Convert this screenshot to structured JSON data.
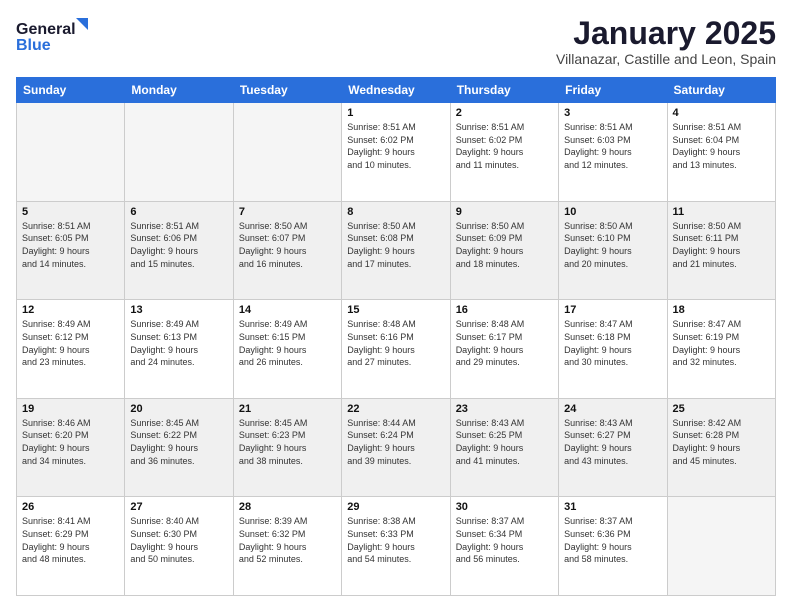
{
  "logo": {
    "line1": "General",
    "line2": "Blue"
  },
  "title": "January 2025",
  "location": "Villanazar, Castille and Leon, Spain",
  "weekdays": [
    "Sunday",
    "Monday",
    "Tuesday",
    "Wednesday",
    "Thursday",
    "Friday",
    "Saturday"
  ],
  "weeks": [
    [
      {
        "day": "",
        "info": ""
      },
      {
        "day": "",
        "info": ""
      },
      {
        "day": "",
        "info": ""
      },
      {
        "day": "1",
        "info": "Sunrise: 8:51 AM\nSunset: 6:02 PM\nDaylight: 9 hours\nand 10 minutes."
      },
      {
        "day": "2",
        "info": "Sunrise: 8:51 AM\nSunset: 6:02 PM\nDaylight: 9 hours\nand 11 minutes."
      },
      {
        "day": "3",
        "info": "Sunrise: 8:51 AM\nSunset: 6:03 PM\nDaylight: 9 hours\nand 12 minutes."
      },
      {
        "day": "4",
        "info": "Sunrise: 8:51 AM\nSunset: 6:04 PM\nDaylight: 9 hours\nand 13 minutes."
      }
    ],
    [
      {
        "day": "5",
        "info": "Sunrise: 8:51 AM\nSunset: 6:05 PM\nDaylight: 9 hours\nand 14 minutes."
      },
      {
        "day": "6",
        "info": "Sunrise: 8:51 AM\nSunset: 6:06 PM\nDaylight: 9 hours\nand 15 minutes."
      },
      {
        "day": "7",
        "info": "Sunrise: 8:50 AM\nSunset: 6:07 PM\nDaylight: 9 hours\nand 16 minutes."
      },
      {
        "day": "8",
        "info": "Sunrise: 8:50 AM\nSunset: 6:08 PM\nDaylight: 9 hours\nand 17 minutes."
      },
      {
        "day": "9",
        "info": "Sunrise: 8:50 AM\nSunset: 6:09 PM\nDaylight: 9 hours\nand 18 minutes."
      },
      {
        "day": "10",
        "info": "Sunrise: 8:50 AM\nSunset: 6:10 PM\nDaylight: 9 hours\nand 20 minutes."
      },
      {
        "day": "11",
        "info": "Sunrise: 8:50 AM\nSunset: 6:11 PM\nDaylight: 9 hours\nand 21 minutes."
      }
    ],
    [
      {
        "day": "12",
        "info": "Sunrise: 8:49 AM\nSunset: 6:12 PM\nDaylight: 9 hours\nand 23 minutes."
      },
      {
        "day": "13",
        "info": "Sunrise: 8:49 AM\nSunset: 6:13 PM\nDaylight: 9 hours\nand 24 minutes."
      },
      {
        "day": "14",
        "info": "Sunrise: 8:49 AM\nSunset: 6:15 PM\nDaylight: 9 hours\nand 26 minutes."
      },
      {
        "day": "15",
        "info": "Sunrise: 8:48 AM\nSunset: 6:16 PM\nDaylight: 9 hours\nand 27 minutes."
      },
      {
        "day": "16",
        "info": "Sunrise: 8:48 AM\nSunset: 6:17 PM\nDaylight: 9 hours\nand 29 minutes."
      },
      {
        "day": "17",
        "info": "Sunrise: 8:47 AM\nSunset: 6:18 PM\nDaylight: 9 hours\nand 30 minutes."
      },
      {
        "day": "18",
        "info": "Sunrise: 8:47 AM\nSunset: 6:19 PM\nDaylight: 9 hours\nand 32 minutes."
      }
    ],
    [
      {
        "day": "19",
        "info": "Sunrise: 8:46 AM\nSunset: 6:20 PM\nDaylight: 9 hours\nand 34 minutes."
      },
      {
        "day": "20",
        "info": "Sunrise: 8:45 AM\nSunset: 6:22 PM\nDaylight: 9 hours\nand 36 minutes."
      },
      {
        "day": "21",
        "info": "Sunrise: 8:45 AM\nSunset: 6:23 PM\nDaylight: 9 hours\nand 38 minutes."
      },
      {
        "day": "22",
        "info": "Sunrise: 8:44 AM\nSunset: 6:24 PM\nDaylight: 9 hours\nand 39 minutes."
      },
      {
        "day": "23",
        "info": "Sunrise: 8:43 AM\nSunset: 6:25 PM\nDaylight: 9 hours\nand 41 minutes."
      },
      {
        "day": "24",
        "info": "Sunrise: 8:43 AM\nSunset: 6:27 PM\nDaylight: 9 hours\nand 43 minutes."
      },
      {
        "day": "25",
        "info": "Sunrise: 8:42 AM\nSunset: 6:28 PM\nDaylight: 9 hours\nand 45 minutes."
      }
    ],
    [
      {
        "day": "26",
        "info": "Sunrise: 8:41 AM\nSunset: 6:29 PM\nDaylight: 9 hours\nand 48 minutes."
      },
      {
        "day": "27",
        "info": "Sunrise: 8:40 AM\nSunset: 6:30 PM\nDaylight: 9 hours\nand 50 minutes."
      },
      {
        "day": "28",
        "info": "Sunrise: 8:39 AM\nSunset: 6:32 PM\nDaylight: 9 hours\nand 52 minutes."
      },
      {
        "day": "29",
        "info": "Sunrise: 8:38 AM\nSunset: 6:33 PM\nDaylight: 9 hours\nand 54 minutes."
      },
      {
        "day": "30",
        "info": "Sunrise: 8:37 AM\nSunset: 6:34 PM\nDaylight: 9 hours\nand 56 minutes."
      },
      {
        "day": "31",
        "info": "Sunrise: 8:37 AM\nSunset: 6:36 PM\nDaylight: 9 hours\nand 58 minutes."
      },
      {
        "day": "",
        "info": ""
      }
    ]
  ]
}
